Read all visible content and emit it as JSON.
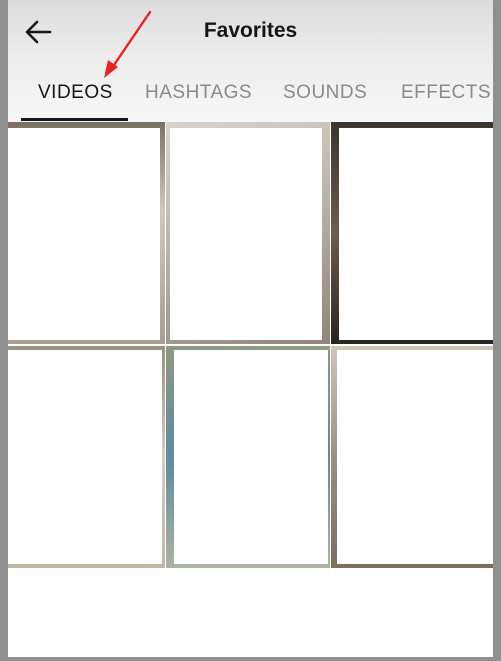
{
  "header": {
    "title": "Favorites",
    "back_icon": "arrow-left-icon"
  },
  "tabs": [
    {
      "label": "VIDEOS",
      "active": true
    },
    {
      "label": "HASHTAGS",
      "active": false
    },
    {
      "label": "SOUNDS",
      "active": false
    },
    {
      "label": "EFFECTS",
      "active": false
    }
  ],
  "annotation": {
    "icon": "red-arrow-annotation",
    "color": "#e8231f"
  },
  "videos_grid": {
    "columns": 3,
    "rows": 2,
    "items": [
      {
        "thumbnail": "redacted"
      },
      {
        "thumbnail": "redacted"
      },
      {
        "thumbnail": "redacted"
      },
      {
        "thumbnail": "redacted"
      },
      {
        "thumbnail": "redacted"
      },
      {
        "thumbnail": "redacted"
      }
    ]
  },
  "colors": {
    "background_frame": "#8f8f8f",
    "active_tab": "#161616",
    "inactive_tab": "#8a8a8a"
  }
}
